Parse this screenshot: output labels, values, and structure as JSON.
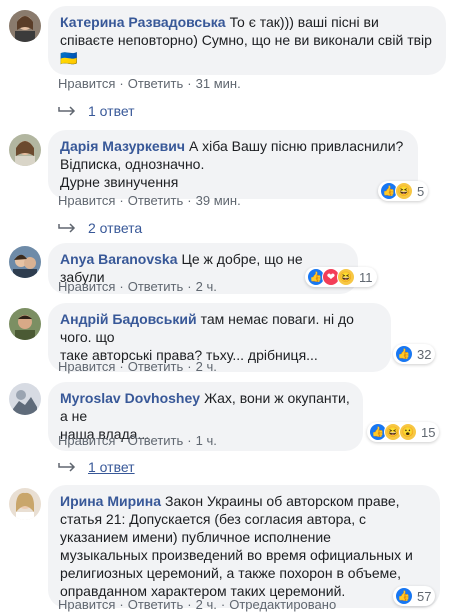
{
  "comments": [
    {
      "author": "Катерина Развадовська",
      "text": "То є так))) ваші пісні ви співаєте неповторно) Сумно, що не ви виконали свій твір🇺🇦",
      "like": "Нравится",
      "reply": "Ответить",
      "time": "31 мин.",
      "replies_label": "1 ответ"
    },
    {
      "author": "Дарія Мазуркевич",
      "text_lines": [
        "А хіба Вашу пісню привласнили?",
        "Відписка, однозначно.",
        "Дурне звинучення"
      ],
      "like": "Нравится",
      "reply": "Ответить",
      "time": "39 мин.",
      "reaction_count": "5",
      "replies_label": "2 ответа"
    },
    {
      "author": "Anya Baranovska",
      "text": "Це ж добре, що не забули",
      "like": "Нравится",
      "reply": "Ответить",
      "time": "2 ч.",
      "reaction_count": "11"
    },
    {
      "author": "Андрій Бадовський",
      "text_lines": [
        "там немає поваги. ні до чого. що",
        "таке авторські права? тьху... дрібниця..."
      ],
      "like": "Нравится",
      "reply": "Ответить",
      "time": "2 ч.",
      "reaction_count": "32"
    },
    {
      "author": "Myroslav Dovhoshey",
      "text_lines": [
        "Жах, вони ж окупанти, а не",
        "наша влада..."
      ],
      "like": "Нравится",
      "reply": "Ответить",
      "time": "1 ч.",
      "reaction_count": "15",
      "replies_label": "1 ответ"
    },
    {
      "author": "Ирина Мирина",
      "text_lines": [
        "Закон Украины об авторском праве,",
        "статья 21: Допускается (без согласия автора, с",
        "указанием имени) публичное исполнение",
        "музыкальных произведений во время официальных и",
        "религиозных церемоний, а также похорон в объеме,",
        "оправданном характером таких церемоний."
      ],
      "like": "Нравится",
      "reply": "Ответить",
      "time": "2 ч.",
      "edited": "Отредактировано",
      "reaction_count": "57"
    }
  ]
}
